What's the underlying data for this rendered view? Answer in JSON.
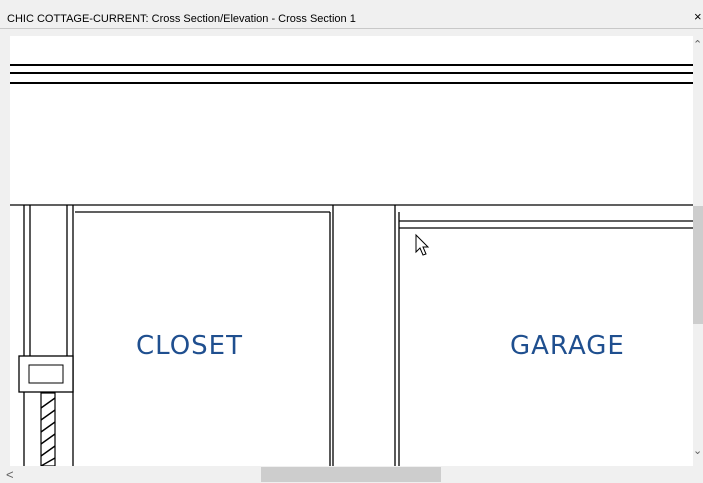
{
  "window": {
    "title": "CHIC COTTAGE-CURRENT: Cross Section/Elevation - Cross Section 1",
    "close_glyph": "×"
  },
  "drawing": {
    "rooms": [
      {
        "label": "CLOSET"
      },
      {
        "label": "GARAGE"
      }
    ],
    "label_color": "#1f4f8f"
  },
  "scrollbars": {
    "up_glyph": "⌃",
    "down_glyph": "⌄",
    "left_glyph": "<"
  }
}
